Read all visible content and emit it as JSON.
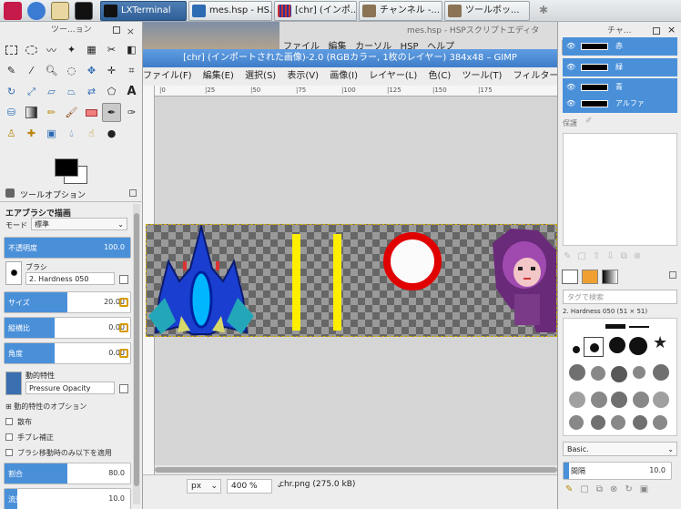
{
  "taskbar": {
    "tasks": [
      {
        "label": "LXTerminal",
        "active": true
      },
      {
        "label": "mes.hsp - HS..."
      },
      {
        "label": "[chr] (インポ..."
      },
      {
        "label": "チャンネル -..."
      },
      {
        "label": "ツールボッ..."
      }
    ]
  },
  "toolbox": {
    "title": "ツー...ョン",
    "options_tab": "ツールオプション",
    "tool_title": "エアブラシで描画",
    "mode_label": "モード",
    "mode_value": "標準",
    "opacity": {
      "label": "不透明度",
      "value": "100.0",
      "fraction": 1.0
    },
    "brush_label": "ブラシ",
    "brush_value": "2. Hardness 050",
    "size": {
      "label": "サイズ",
      "value": "20.00",
      "fraction": 0.5
    },
    "aspect": {
      "label": "縦横比",
      "value": "0.00",
      "fraction": 0.4
    },
    "angle": {
      "label": "角度",
      "value": "0.00",
      "fraction": 0.4
    },
    "dynamics_label": "動的特性",
    "dynamics_value": "Pressure Opacity",
    "dynamics_options": "動的特性のオプション",
    "scatter": "散布",
    "smooth": "手ブレ補正",
    "incremental": "ブラシ移動時のみ以下を適用",
    "rate": {
      "label": "割合",
      "value": "80.0",
      "fraction": 0.5
    },
    "flow": {
      "label": "流量",
      "value": "10.0",
      "fraction": 0.1
    }
  },
  "hsp": {
    "title": "mes.hsp - HSPスクリプトエディタ",
    "menu": [
      "ファイル",
      "編集",
      "カーソル",
      "HSP",
      "ヘルプ"
    ]
  },
  "gimp": {
    "title": "[chr] (インポートされた画像)-2.0 (RGBカラー, 1枚のレイヤー) 384x48 – GIMP",
    "menu": [
      "ファイル(F)",
      "編集(E)",
      "選択(S)",
      "表示(V)",
      "画像(I)",
      "レイヤー(L)",
      "色(C)",
      "ツール(T)",
      "フィルター(R)",
      "ウ"
    ],
    "ruler": [
      "|0",
      "|25",
      "|50",
      "|75",
      "|100",
      "|125",
      "|150",
      "|175"
    ],
    "unit": "px",
    "zoom": "400 %",
    "status": "chr.png (275.0 kB)"
  },
  "right": {
    "title": "チャ...",
    "channels": [
      "赤",
      "緑",
      "青",
      "アルファ"
    ],
    "lock_label": "保護",
    "tag_placeholder": "タグで検索",
    "brush_name": "2. Hardness 050 (51 × 51)",
    "preset": "Basic.",
    "spacing": {
      "label": "間隔",
      "value": "10.0",
      "fraction": 0.05
    }
  },
  "colors": {
    "accent": "#4a90d9",
    "title_blue": "#3f7dc8"
  }
}
